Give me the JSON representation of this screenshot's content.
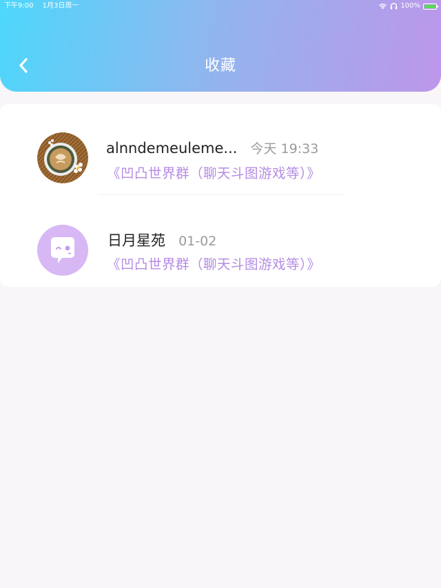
{
  "status_bar": {
    "time": "下午9:00",
    "date": "1月3日周一",
    "battery": "100%",
    "battery_level": 1.0
  },
  "header": {
    "title": "收藏",
    "back_icon": "chevron-left-icon"
  },
  "favorites": [
    {
      "name": "alnndemeuleme...",
      "time": "今天 19:33",
      "message": "《凹凸世界群（聊天斗图游戏等）》",
      "avatar": "coffee-photo"
    },
    {
      "name": "日月星苑",
      "time": "01-02",
      "message": "《凹凸世界群（聊天斗图游戏等）》",
      "avatar": "chat-bubble-face-icon"
    }
  ],
  "colors": {
    "header_gradient_start": "#4dd7fb",
    "header_gradient_end": "#bd96ea",
    "message_text": "#b58be3",
    "avatar_purple": "#d7b8f5"
  }
}
